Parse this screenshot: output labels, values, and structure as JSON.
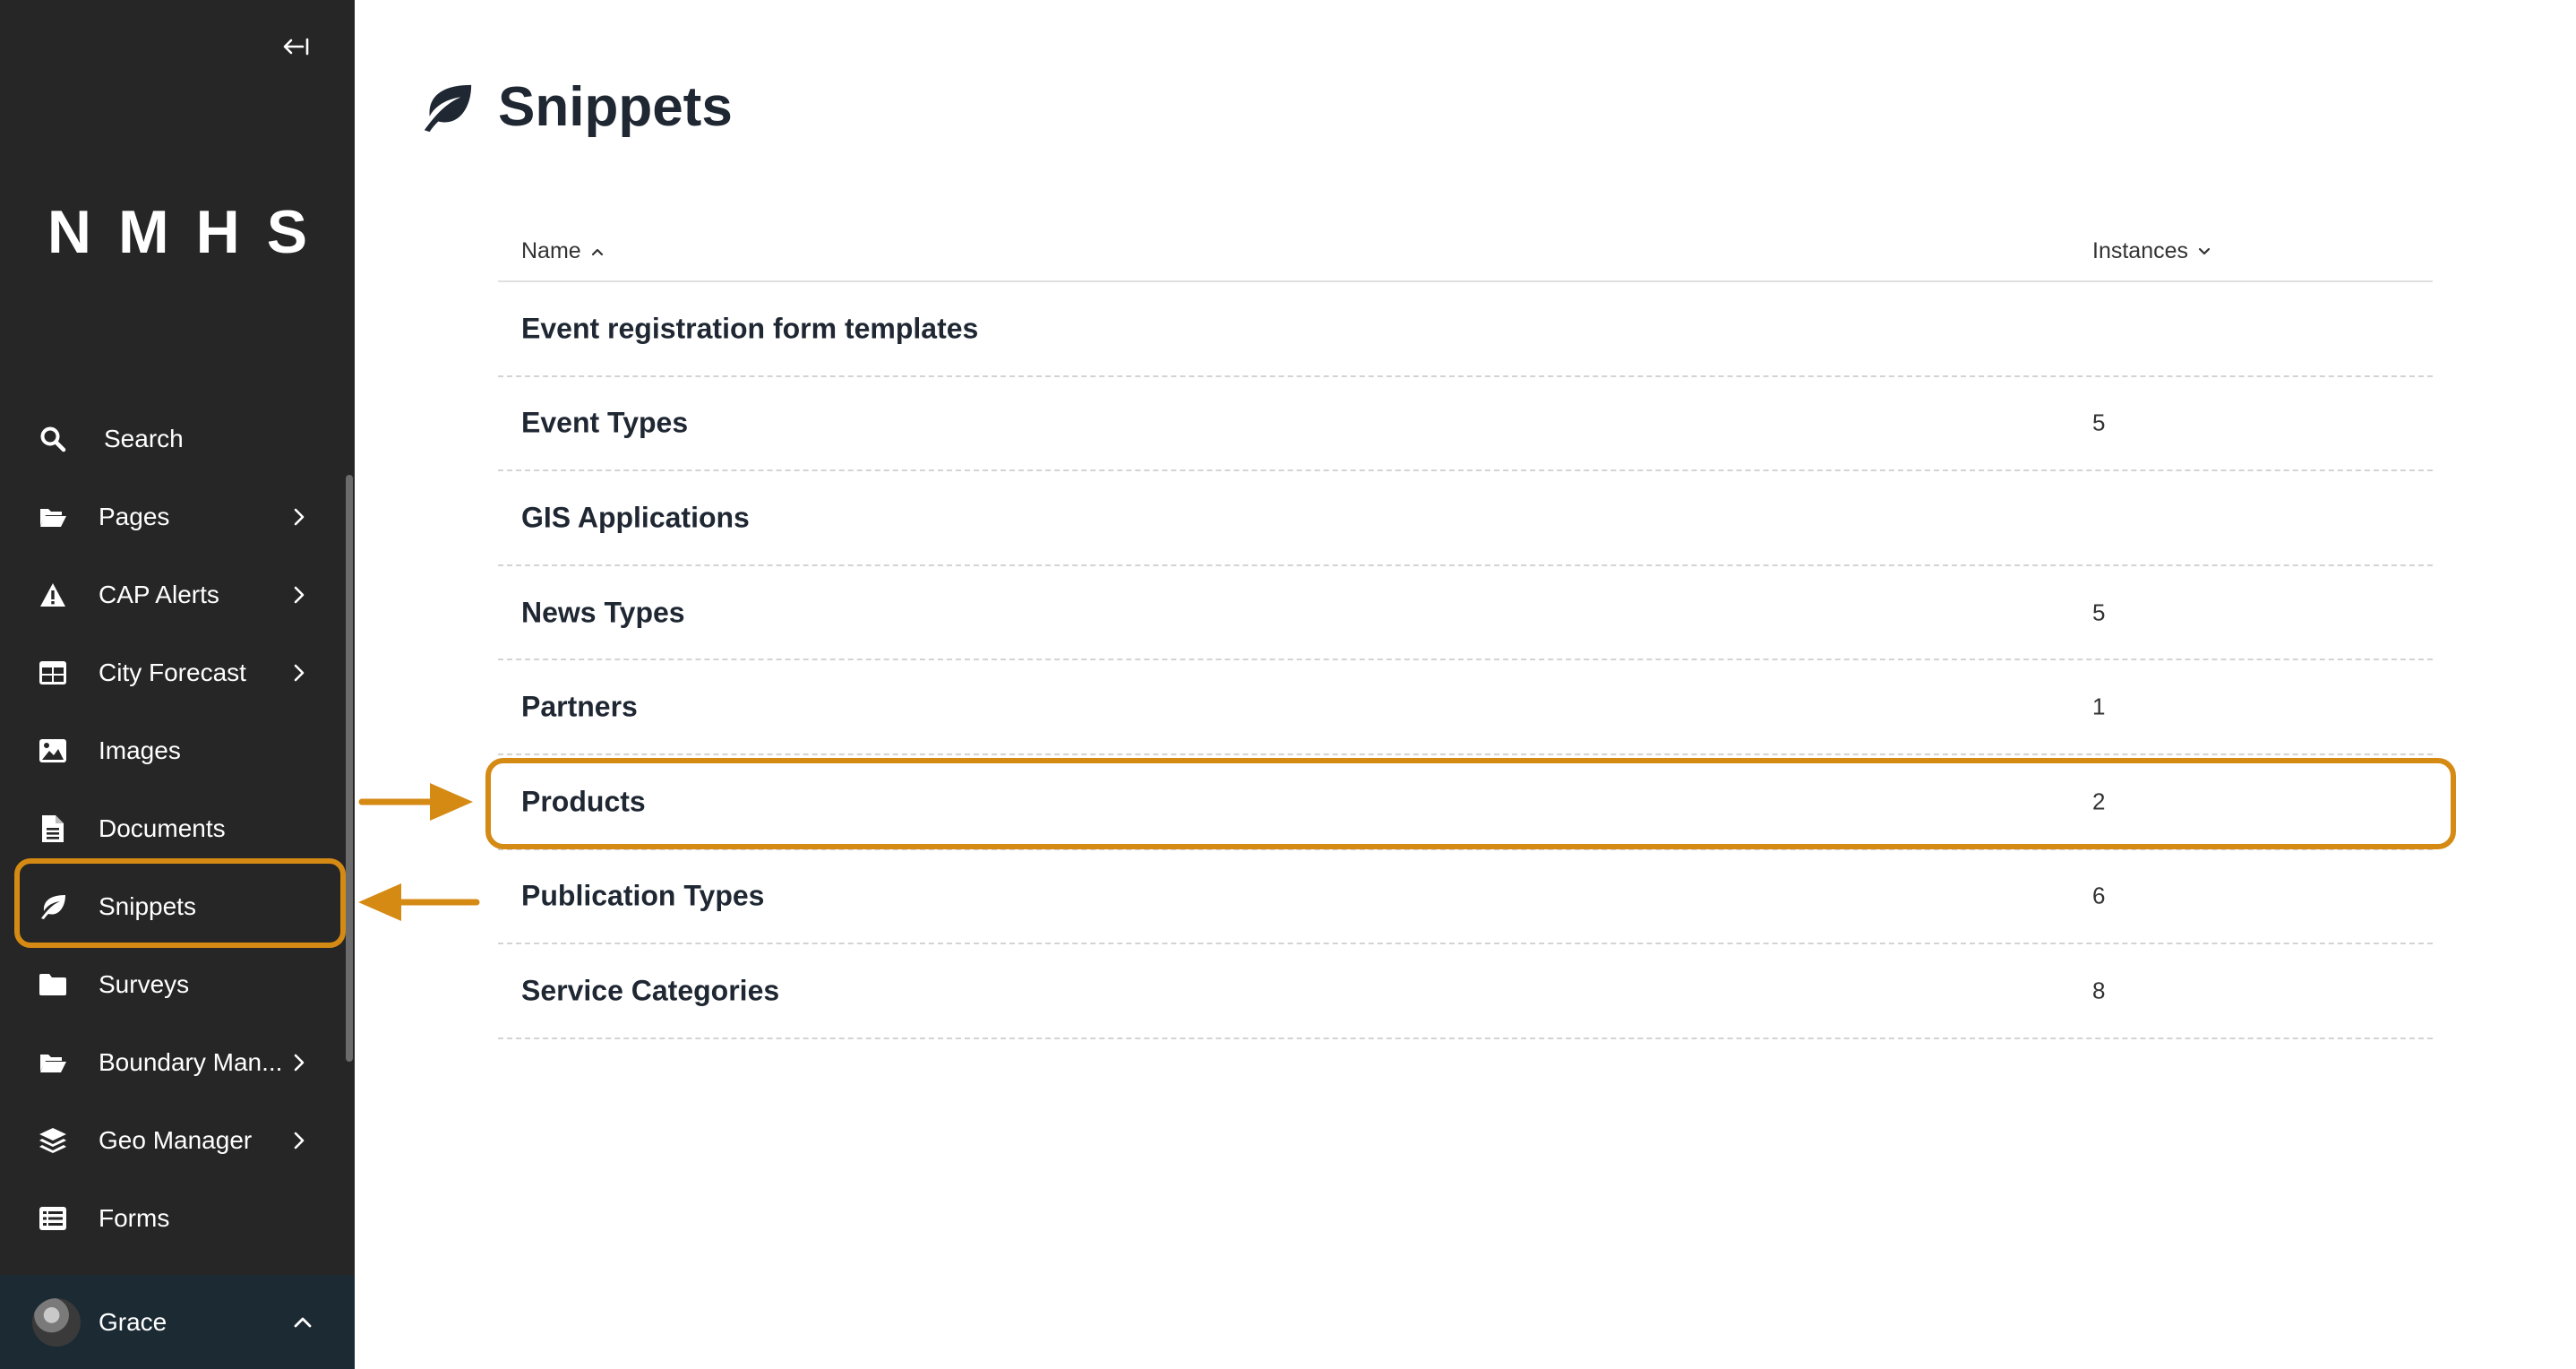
{
  "sidebar": {
    "logo": "NMHS",
    "items": [
      {
        "label": "Search",
        "icon": "search-icon",
        "has_submenu": false
      },
      {
        "label": "Pages",
        "icon": "folder-open-icon",
        "has_submenu": true
      },
      {
        "label": "CAP Alerts",
        "icon": "warning-icon",
        "has_submenu": true
      },
      {
        "label": "City Forecast",
        "icon": "table-icon",
        "has_submenu": true
      },
      {
        "label": "Images",
        "icon": "image-icon",
        "has_submenu": false
      },
      {
        "label": "Documents",
        "icon": "document-icon",
        "has_submenu": false
      },
      {
        "label": "Snippets",
        "icon": "leaf-icon",
        "has_submenu": false,
        "active": true
      },
      {
        "label": "Surveys",
        "icon": "folder-icon",
        "has_submenu": false
      },
      {
        "label": "Boundary Man...",
        "icon": "folder-open-icon",
        "has_submenu": true
      },
      {
        "label": "Geo Manager",
        "icon": "layers-icon",
        "has_submenu": true
      },
      {
        "label": "Forms",
        "icon": "list-icon",
        "has_submenu": false
      }
    ],
    "account": {
      "name": "Grace"
    }
  },
  "header": {
    "title": "Snippets",
    "icon": "leaf-icon"
  },
  "table": {
    "columns": {
      "name": "Name",
      "instances": "Instances"
    },
    "rows": [
      {
        "name": "Event registration form templates",
        "instances": ""
      },
      {
        "name": "Event Types",
        "instances": "5"
      },
      {
        "name": "GIS Applications",
        "instances": ""
      },
      {
        "name": "News Types",
        "instances": "5"
      },
      {
        "name": "Partners",
        "instances": "1"
      },
      {
        "name": "Products",
        "instances": "2"
      },
      {
        "name": "Publication Types",
        "instances": "6"
      },
      {
        "name": "Service Categories",
        "instances": "8"
      }
    ]
  },
  "colors": {
    "sidebar_bg": "#262626",
    "account_bg": "#1c2a33",
    "highlight": "#d58a14",
    "title": "#1f2733"
  }
}
